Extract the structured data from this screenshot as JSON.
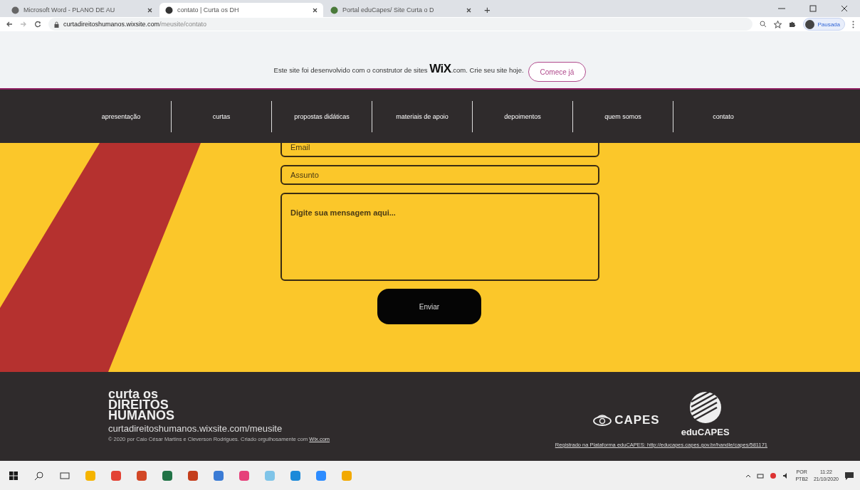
{
  "browser": {
    "tabs": [
      {
        "title": "Microsoft Word - PLANO DE AU",
        "selected": false
      },
      {
        "title": "contato | Curta os DH",
        "selected": true
      },
      {
        "title": "Portal eduCapes/ Site Curta o D",
        "selected": false
      }
    ],
    "new_tab": "+",
    "address": "curtadireitoshumanos.wixsite.com",
    "address_path": "/meusite/contato",
    "profile": "Pausada"
  },
  "banner": {
    "text": "Este site foi desenvolvido com o construtor de sites",
    "brand": "WiX",
    "brand_suffix": ".com. Crie seu site hoje.",
    "button": "Comece já"
  },
  "nav": [
    {
      "label": "apresentação"
    },
    {
      "label": "curtas"
    },
    {
      "label": "propostas didáticas"
    },
    {
      "label": "materiais de apoio"
    },
    {
      "label": "depoimentos"
    },
    {
      "label": "quem somos"
    },
    {
      "label": "contato"
    }
  ],
  "form": {
    "fields": [
      {
        "kind": "input",
        "placeholder": "Email"
      },
      {
        "kind": "input",
        "placeholder": "Assunto"
      },
      {
        "kind": "textarea",
        "placeholder": "Digite sua mensagem aqui..."
      }
    ],
    "submit": "Enviar"
  },
  "footer": {
    "logo_lines": [
      "curta os",
      "DIREITOS",
      "HUMANOS"
    ],
    "site_url": "curtadireitoshumanos.wixsite.com/meusite",
    "copyright": "© 2020 por Caio César Martins e Cleverson Rodrigues. Criado orgulhosamente com",
    "copyright_link": "Wix.com",
    "capes": "CAPES",
    "educapes": "eduCAPES",
    "registry_link": "Registrado na Plataforma eduCAPES: http://educapes.capes.gov.br/handle/capes/581171"
  },
  "taskbar": {
    "language": "POR",
    "layout": "PTB2",
    "time": "11:22",
    "date": "21/10/2020"
  }
}
